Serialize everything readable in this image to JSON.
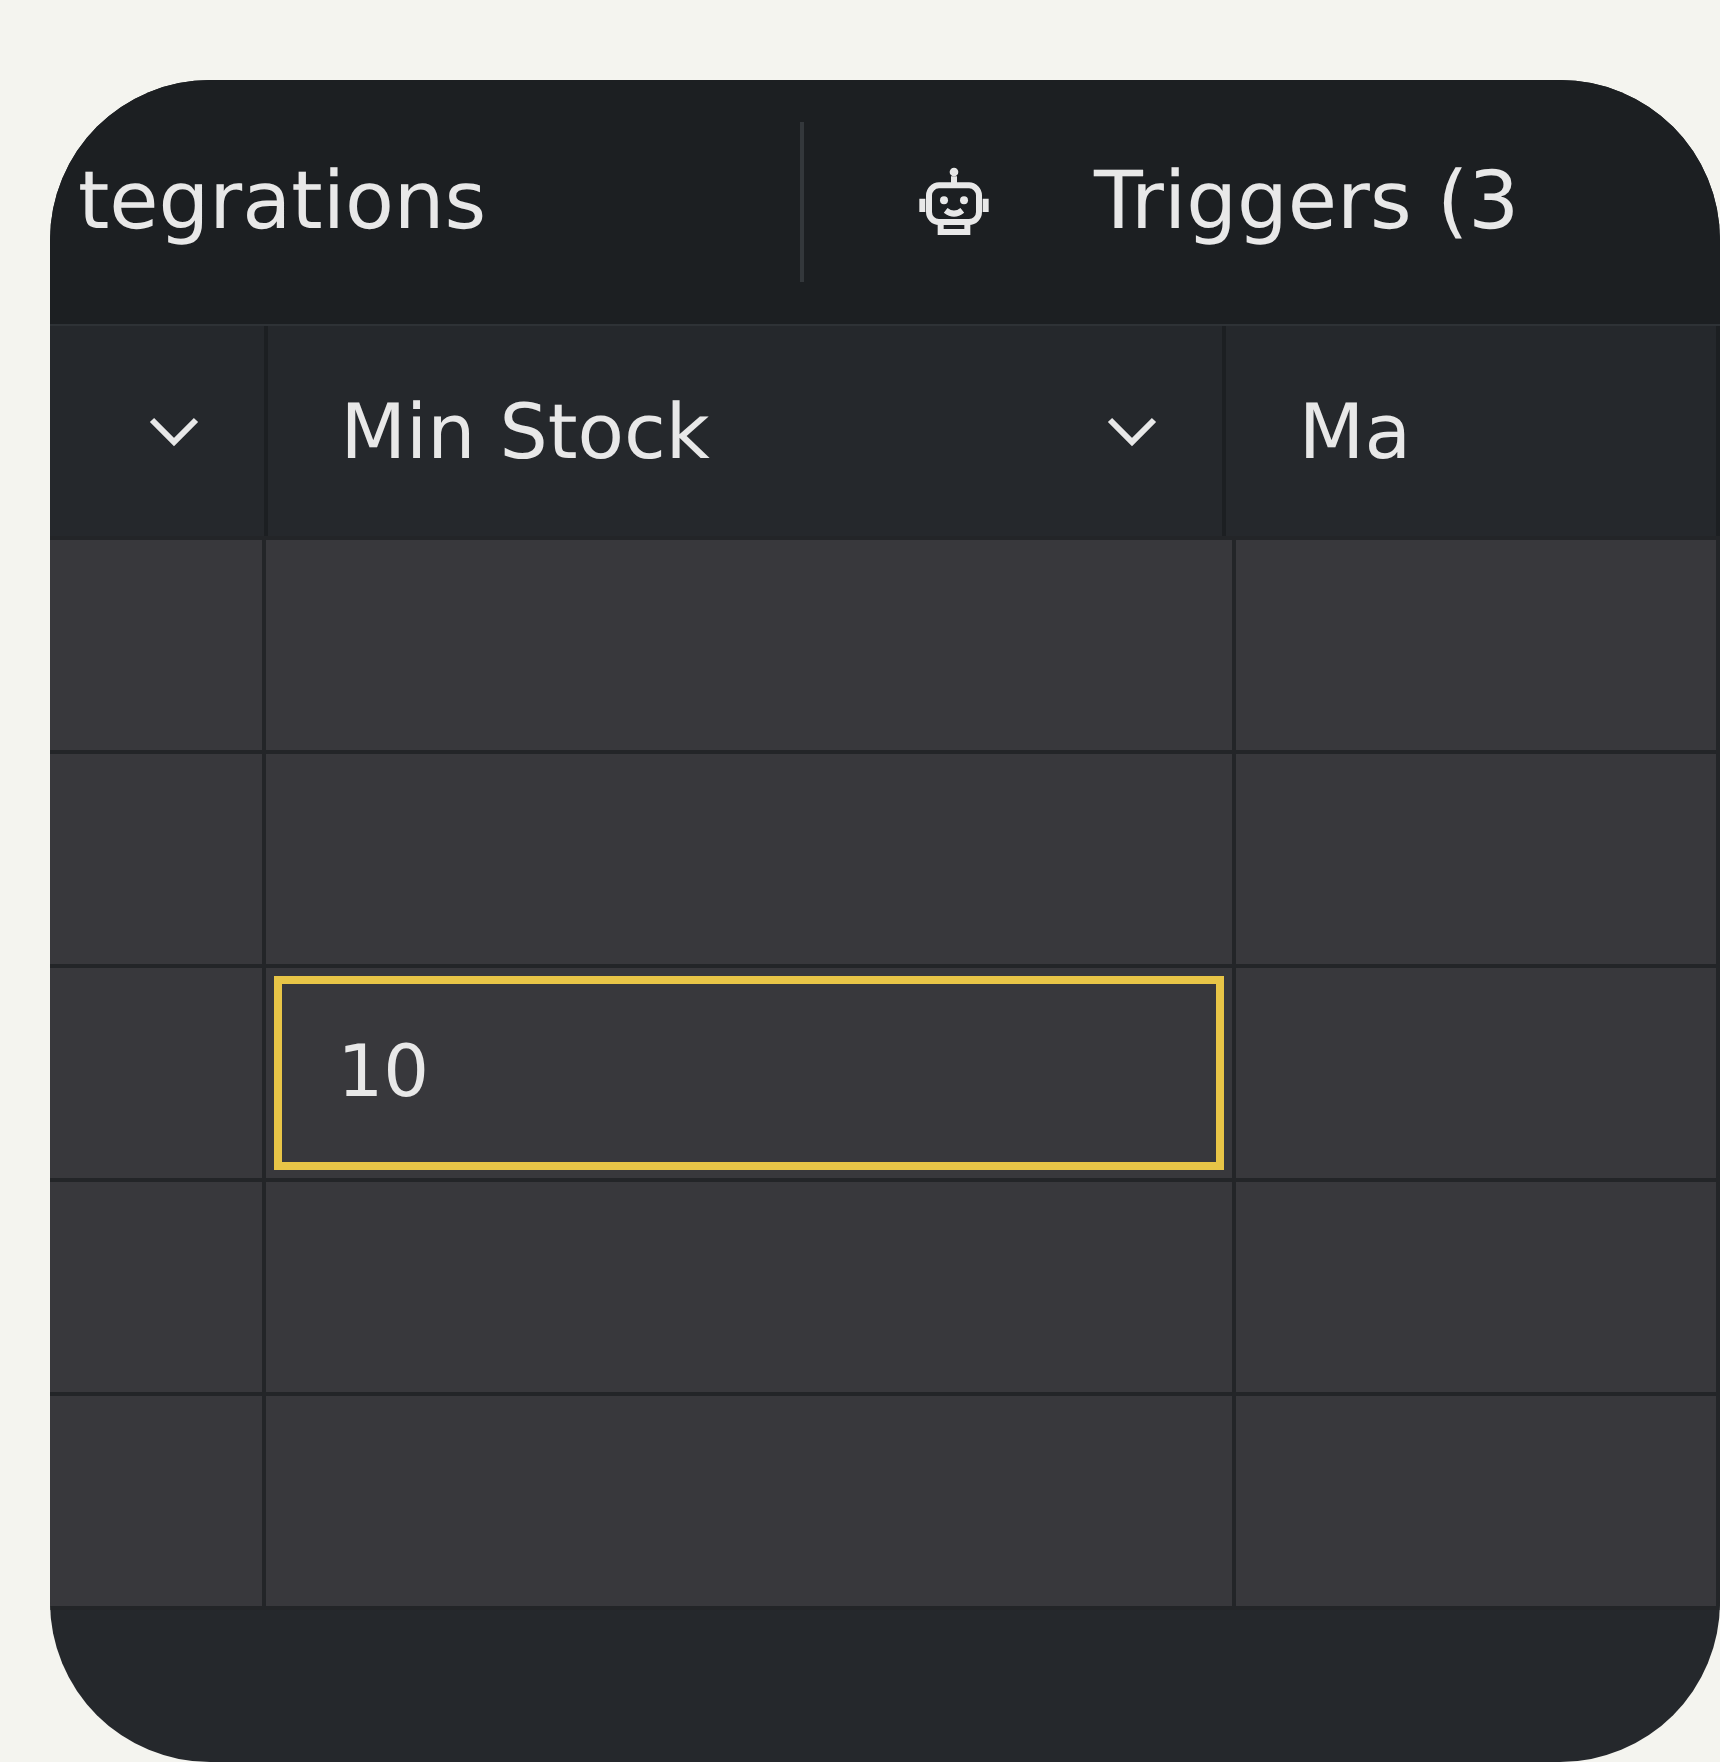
{
  "tabs": [
    {
      "label": "tegrations",
      "kind": "plain"
    },
    {
      "label": "Triggers (3",
      "kind": "robot"
    }
  ],
  "columns": [
    {
      "menu": true
    },
    {
      "label": "Min Stock",
      "menu": true
    },
    {
      "label": "Ma",
      "menu": false
    }
  ],
  "rows": [
    {
      "min_stock": "",
      "selected": false
    },
    {
      "min_stock": "",
      "selected": false
    },
    {
      "min_stock": "10",
      "selected": true
    },
    {
      "min_stock": "",
      "selected": false
    },
    {
      "min_stock": "",
      "selected": false
    }
  ]
}
